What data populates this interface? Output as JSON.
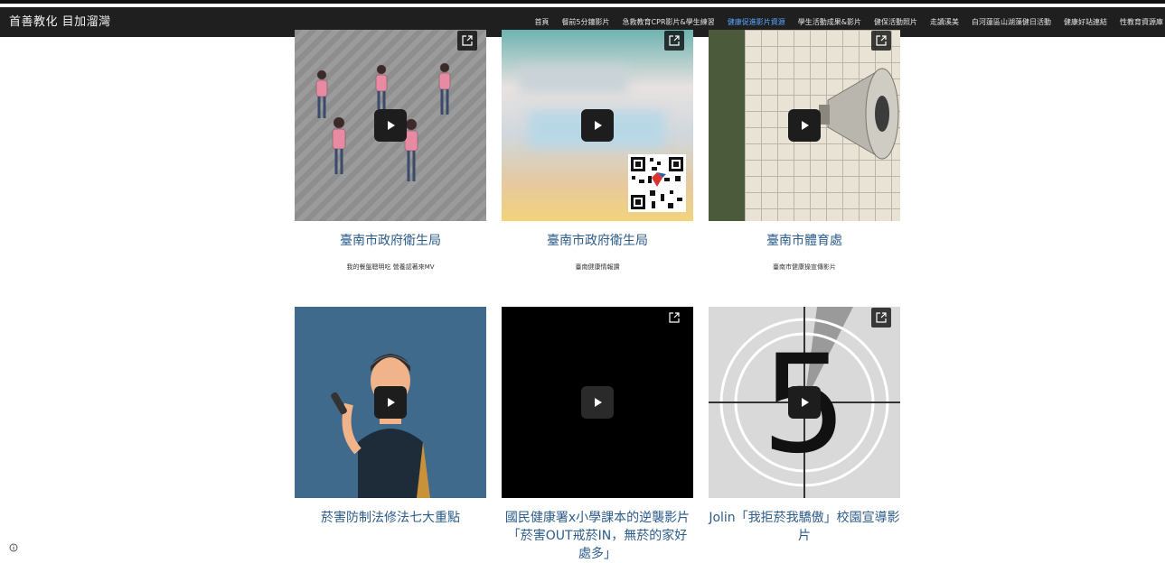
{
  "header": {
    "brand": "首善教化 目加溜灣",
    "nav": [
      {
        "label": "首頁",
        "active": false
      },
      {
        "label": "餐前5分鐘影片",
        "active": false
      },
      {
        "label": "急救教育CPR影片&學生練習",
        "active": false
      },
      {
        "label": "健康促進影片資源",
        "active": true
      },
      {
        "label": "學生活動成果&影片",
        "active": false
      },
      {
        "label": "健保活動照片",
        "active": false
      },
      {
        "label": "走讀溪美",
        "active": false
      },
      {
        "label": "白河蓮區山湖藻健日活動",
        "active": false
      },
      {
        "label": "健康好站連結",
        "active": false
      },
      {
        "label": "性教育資源庫",
        "active": false
      }
    ]
  },
  "videos": [
    {
      "title": "臺南市政府衛生局",
      "subtitle": "我的餐盤聰明吃 營養認著來MV",
      "thumb_icon": "dancers-thumbnail"
    },
    {
      "title": "臺南市政府衛生局",
      "subtitle": "臺南健康情報讚",
      "thumb_icon": "qr-code-thumbnail"
    },
    {
      "title": "臺南市體育處",
      "subtitle": "臺南市健康操宣傳影片",
      "thumb_icon": "loudspeaker-thumbnail"
    },
    {
      "title": "菸害防制法修法七大重點",
      "subtitle": "",
      "thumb_icon": "man-with-microphone-thumbnail"
    },
    {
      "title": "國民健康署x小學課本的逆襲影片「菸害OUT戒菸IN，無菸的家好處多」",
      "subtitle": "",
      "thumb_icon": "black-thumbnail"
    },
    {
      "title": "Jolin「我拒菸我驕傲」校園宣導影片",
      "subtitle": "",
      "thumb_icon": "countdown-thumbnail",
      "countdown_digit": "5"
    }
  ],
  "colors": {
    "navbar": "#1f1f1f",
    "active_nav": "#5aa6ff",
    "title": "#2d5c8a"
  }
}
